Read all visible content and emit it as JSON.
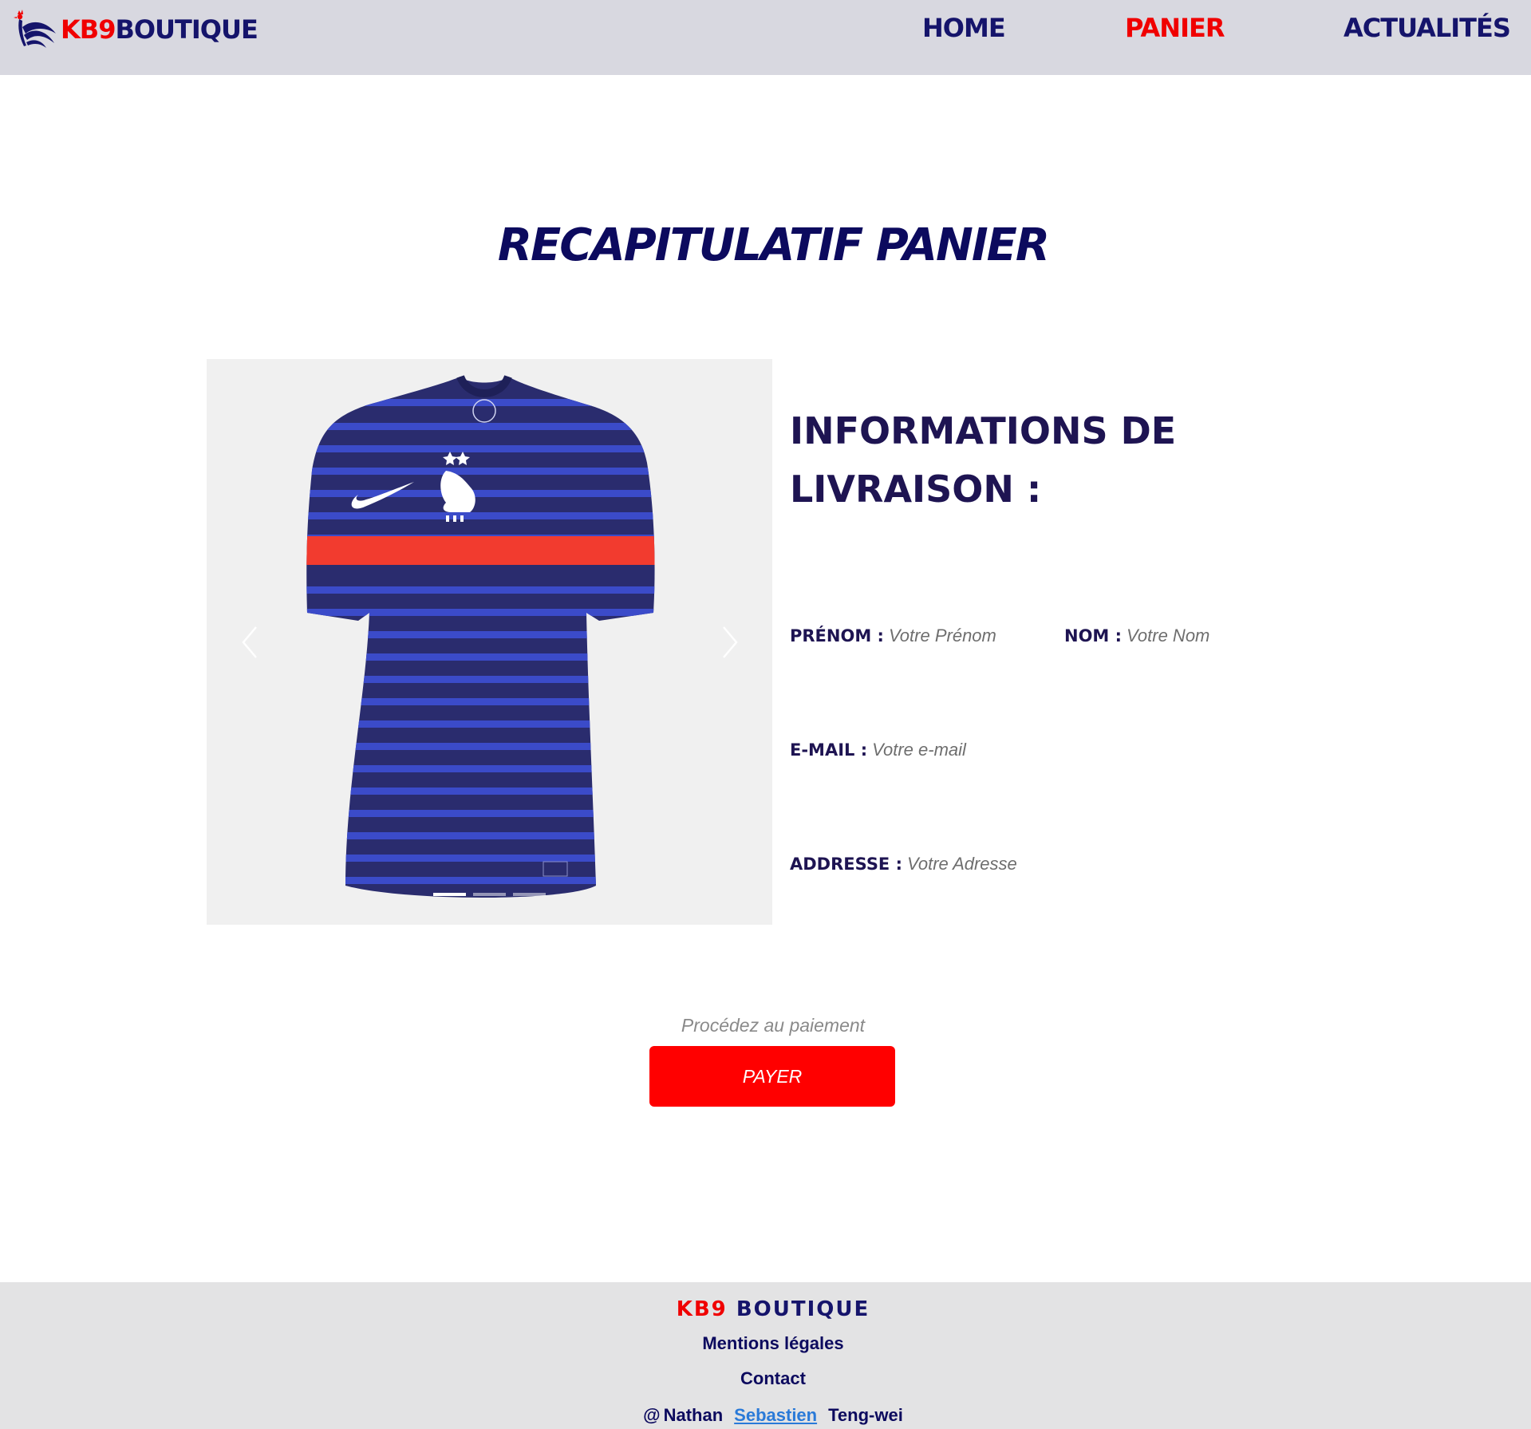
{
  "header": {
    "logo_part1": "KB9",
    "logo_part2": "BOUTIQUE",
    "nav": [
      {
        "label": "HOME"
      },
      {
        "label": "PANIER"
      },
      {
        "label": "ACTUALITÉS"
      }
    ],
    "active_nav": "PANIER"
  },
  "main": {
    "title": "RECAPITULATIF PANIER",
    "carousel": {
      "slide_count": 3,
      "active_slide": 1
    },
    "shipping": {
      "title_line1": "INFORMATIONS DE",
      "title_line2": "LIVRAISON :",
      "fields": {
        "first_name": {
          "label": "PRÉNOM :",
          "placeholder": "Votre Prénom"
        },
        "last_name": {
          "label": "NOM :",
          "placeholder": "Votre Nom"
        },
        "email": {
          "label": "E-MAIL :",
          "placeholder": "Votre e-mail"
        },
        "address": {
          "label": "ADDRESSE :",
          "placeholder": "Votre Adresse"
        }
      }
    },
    "payment": {
      "hint": "Procédez au paiement",
      "button_label": "PAYER"
    }
  },
  "footer": {
    "brand_part1": "KB9",
    "brand_part2": "BOUTIQUE",
    "links": {
      "legal": "Mentions légales",
      "contact": "Contact"
    },
    "credits": {
      "at": "@",
      "authors": [
        "Nathan",
        "Sebastien",
        "Teng-wei"
      ]
    }
  },
  "colors": {
    "brand_red": "#f00000",
    "brand_navy": "#15146b",
    "header_bg": "#d8d8e0",
    "footer_bg": "#e3e3e4",
    "pay_button": "#ff0000",
    "link_blue": "#2a7ad8"
  },
  "icons": {
    "logo": "rooster-icon",
    "carousel_prev": "chevron-left-icon",
    "carousel_next": "chevron-right-icon"
  }
}
